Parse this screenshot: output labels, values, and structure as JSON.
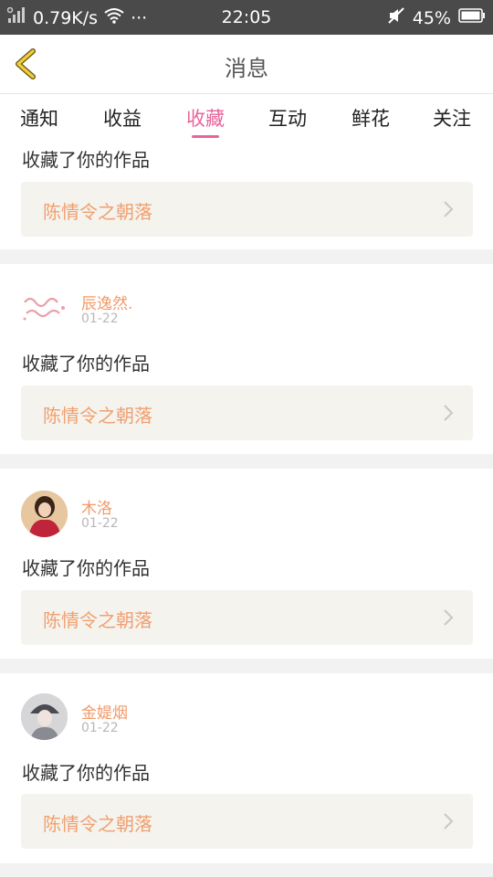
{
  "status_bar": {
    "network_speed": "0.79K/s",
    "more": "···",
    "time": "22:05",
    "battery": "45%"
  },
  "header": {
    "title": "消息",
    "back_icon": "chevron-left-icon"
  },
  "tabs": [
    {
      "label": "通知"
    },
    {
      "label": "收益"
    },
    {
      "label": "收藏",
      "active": true
    },
    {
      "label": "互动"
    },
    {
      "label": "鲜花"
    },
    {
      "label": "关注"
    }
  ],
  "colors": {
    "accent": "#e8659a",
    "username": "#f09a6a",
    "work_title": "#f0a070",
    "work_box_bg": "#f5f3ee"
  },
  "items": [
    {
      "action": "收藏了你的作品",
      "work": "陈情令之朝落"
    },
    {
      "user": "辰逸然.",
      "date": "01-22",
      "action": "收藏了你的作品",
      "work": "陈情令之朝落"
    },
    {
      "user": "木洛",
      "date": "01-22",
      "action": "收藏了你的作品",
      "work": "陈情令之朝落"
    },
    {
      "user": "金媞烟",
      "date": "01-22",
      "action": "收藏了你的作品",
      "work": "陈情令之朝落"
    }
  ]
}
